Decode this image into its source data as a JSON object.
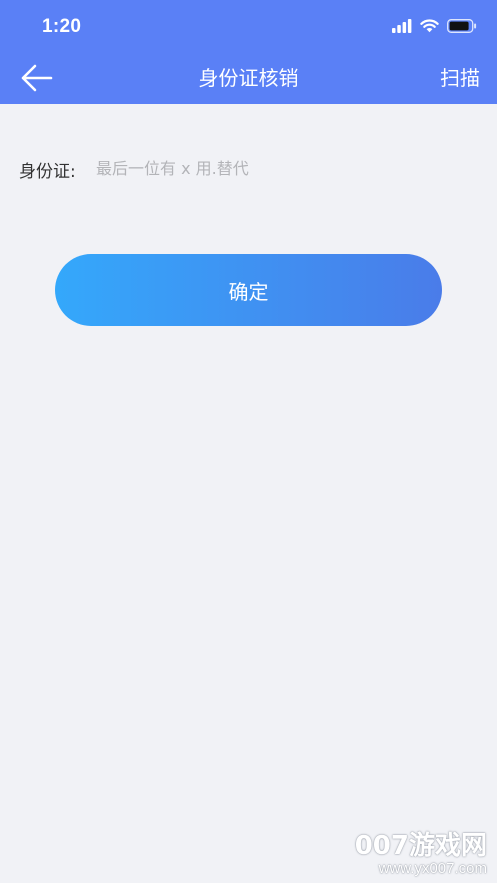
{
  "status_bar": {
    "time": "1:20",
    "icons": [
      "signal-icon",
      "wifi-icon",
      "battery-icon"
    ]
  },
  "nav": {
    "back_icon": "arrow-left-icon",
    "title": "身份证核销",
    "scan_label": "扫描"
  },
  "form": {
    "id_label": "身份证:",
    "id_value": "",
    "id_placeholder": "最后一位有 x 用.替代"
  },
  "actions": {
    "confirm_label": "确定"
  },
  "watermark": {
    "main": "007游戏网",
    "url": "www.yx007.com"
  },
  "colors": {
    "header": "#5a80f6",
    "background": "#f1f2f6",
    "button_start": "#34a8fb",
    "button_end": "#4a7ce9"
  }
}
